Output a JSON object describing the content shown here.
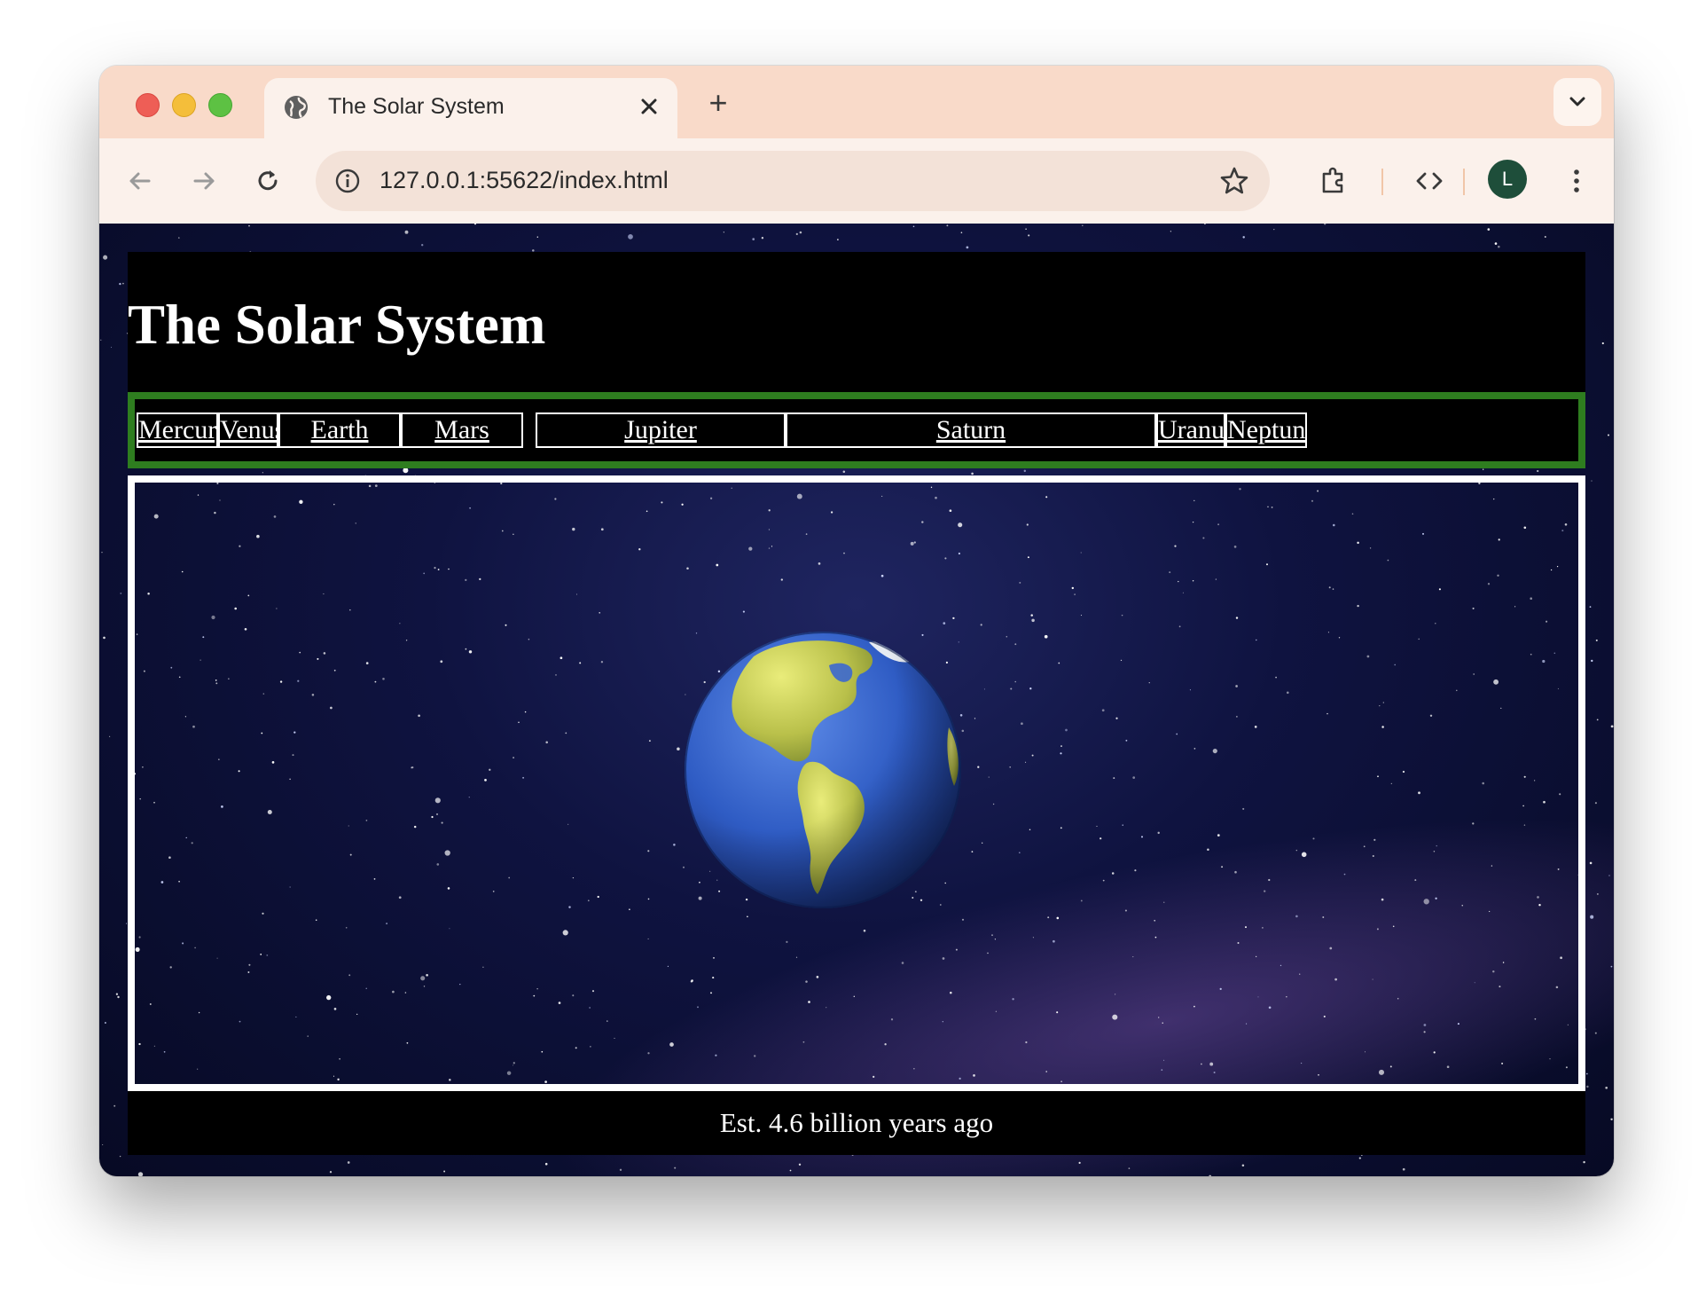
{
  "browser": {
    "tab": {
      "title": "The Solar System",
      "close_icon": "close-icon"
    },
    "new_tab_label": "+",
    "address_bar": {
      "url": "127.0.0.1:55622/index.html"
    },
    "profile_initial": "L"
  },
  "page": {
    "title": "The Solar System",
    "nav": {
      "items": [
        {
          "label": "Mercury"
        },
        {
          "label": "Venus"
        },
        {
          "label": "Earth"
        },
        {
          "label": "Mars"
        },
        {
          "label": "Jupiter"
        },
        {
          "label": "Saturn"
        },
        {
          "label": "Uranus"
        },
        {
          "label": "Neptune"
        }
      ],
      "border_color": "#2E7D1F"
    },
    "main_image": "earth-globe-icon",
    "footer": {
      "text": "Est. 4.6 billion years ago"
    }
  },
  "colors": {
    "tabstrip": "#F9DAC9",
    "toolbar": "#FBF1EB",
    "avatar": "#1E4E3A",
    "page_panels": "#000000",
    "frame_border": "#FFFFFF"
  }
}
